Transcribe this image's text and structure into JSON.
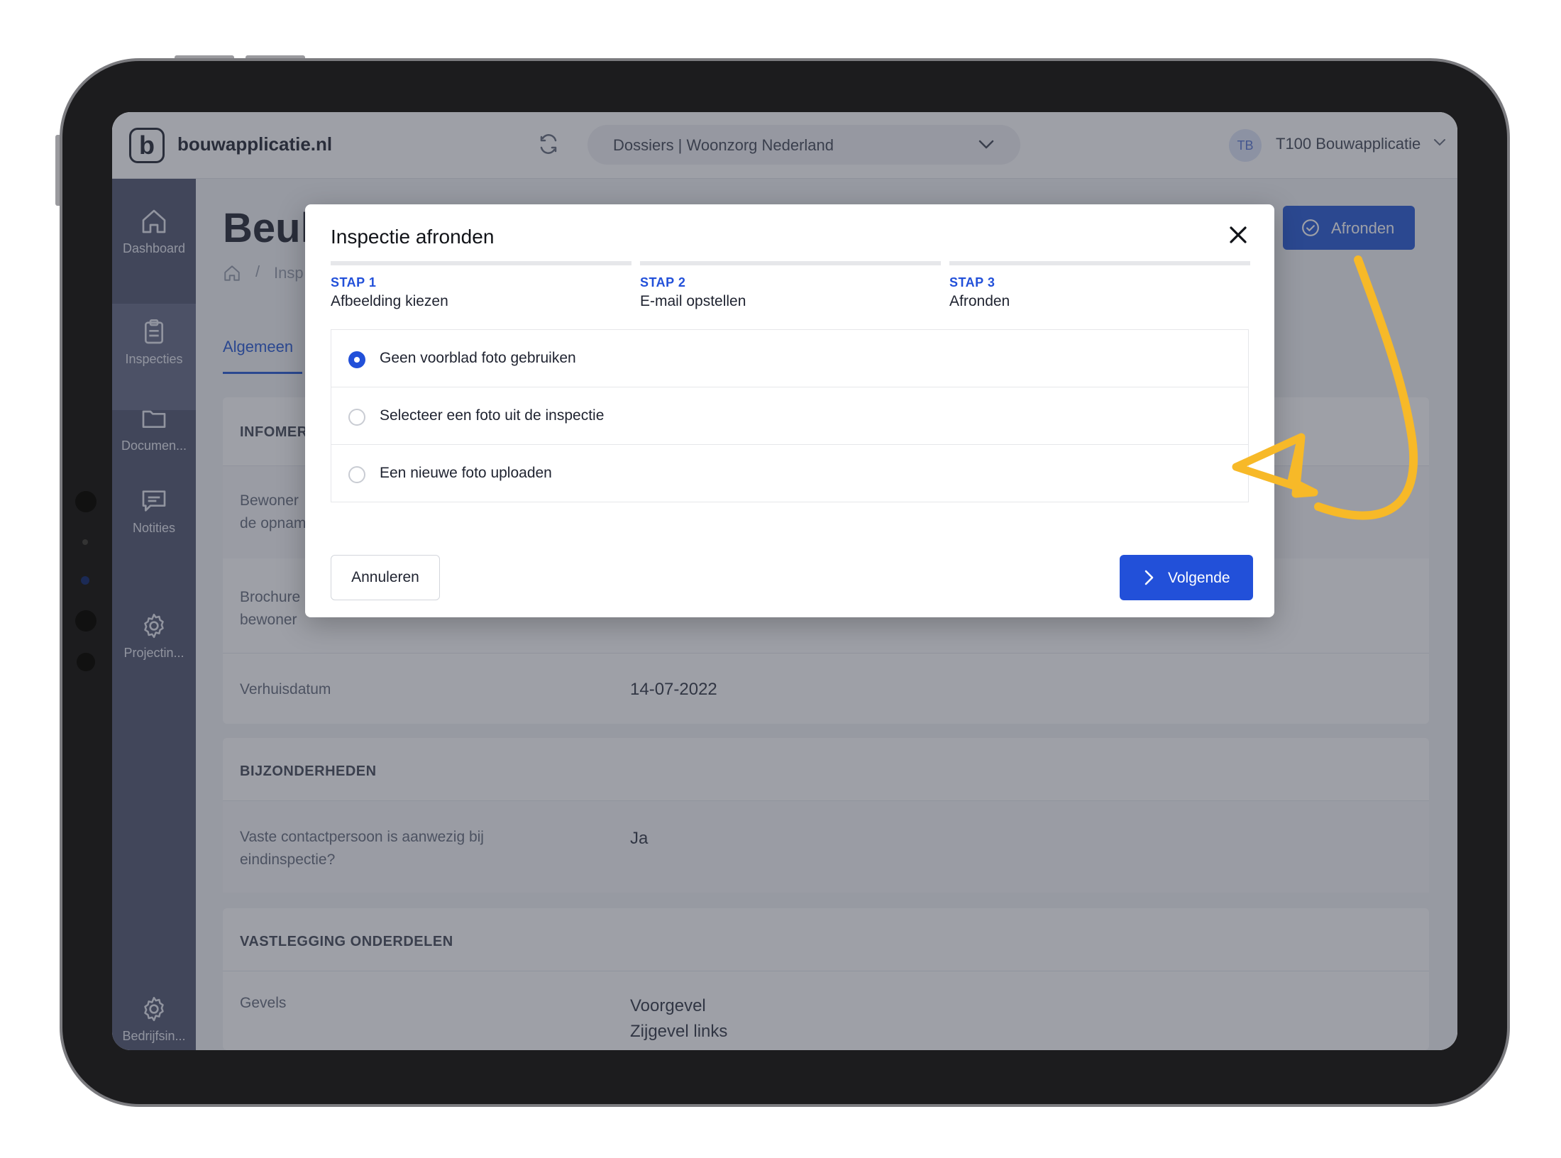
{
  "app": {
    "logo_glyph": "b",
    "name": "bouwapplicatie.nl",
    "dossier_select": "Dossiers | Woonzorg Nederland",
    "user_initials": "TB",
    "user_name": "T100 Bouwapplicatie"
  },
  "sidebar": {
    "items": [
      {
        "label": "Dashboard",
        "icon": "home-icon"
      },
      {
        "label": "Inspecties",
        "icon": "clipboard-icon"
      },
      {
        "label": "Documen...",
        "icon": "folder-icon"
      },
      {
        "label": "Notities",
        "icon": "chat-icon"
      },
      {
        "label": "Projectin...",
        "icon": "gear-icon"
      },
      {
        "label": "Bedrijfsin...",
        "icon": "gear-icon"
      }
    ]
  },
  "page": {
    "title": "Beuk",
    "breadcrumb": "Insp",
    "tab": "Algemeen",
    "finish_button": "Afronden"
  },
  "cards": {
    "info": {
      "header": "INFOMER",
      "rows": [
        {
          "label": "Bewoner de opnam",
          "value": ""
        },
        {
          "label": "Brochure bewoner",
          "value": ""
        },
        {
          "label": "Verhuisdatum",
          "value": "14-07-2022"
        }
      ]
    },
    "details": {
      "header": "BIJZONDERHEDEN",
      "rows": [
        {
          "label": "Vaste contactpersoon is aanwezig bij eindinspectie?",
          "value": "Ja"
        }
      ]
    },
    "parts": {
      "header": "VASTLEGGING ONDERDELEN",
      "rows": [
        {
          "label": "Gevels",
          "value_line1": "Voorgevel",
          "value_line2": "Zijgevel links"
        }
      ]
    }
  },
  "modal": {
    "title": "Inspectie afronden",
    "steps": [
      {
        "num": "STAP 1",
        "name": "Afbeelding kiezen"
      },
      {
        "num": "STAP 2",
        "name": "E-mail opstellen"
      },
      {
        "num": "STAP 3",
        "name": "Afronden"
      }
    ],
    "options": [
      {
        "label": "Geen voorblad foto gebruiken",
        "selected": true
      },
      {
        "label": "Selecteer een foto uit de inspectie",
        "selected": false
      },
      {
        "label": "Een nieuwe foto uploaden",
        "selected": false
      }
    ],
    "cancel_button": "Annuleren",
    "next_button": "Volgende"
  },
  "colors": {
    "primary": "#2250d9",
    "sidebar": "#565c74",
    "annotation_arrow": "#f7b928"
  }
}
